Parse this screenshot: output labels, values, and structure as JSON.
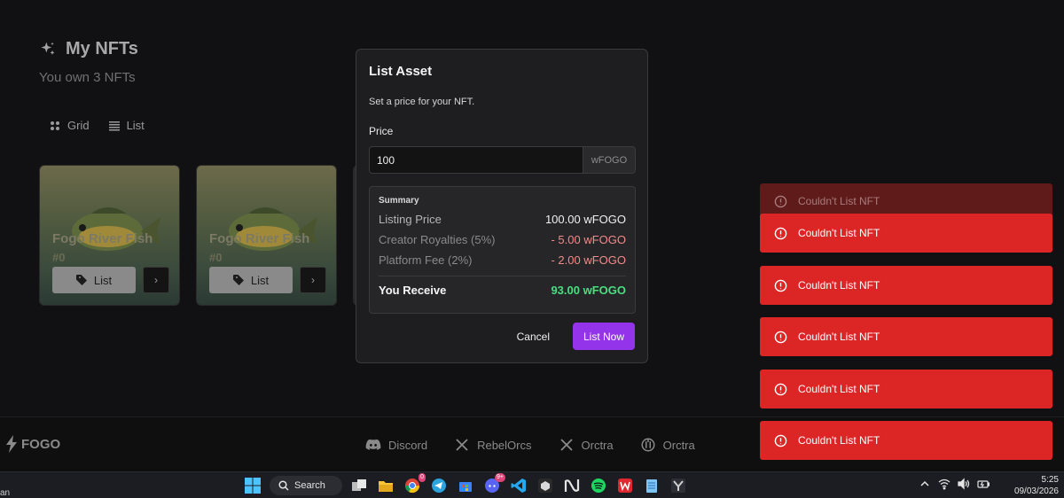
{
  "page": {
    "title": "My NFTs",
    "subtitle": "You own 3 NFTs",
    "view_toggle": {
      "grid_label": "Grid",
      "list_label": "List"
    },
    "cards": [
      {
        "name": "Fogo River Fish",
        "number": "#0",
        "list_label": "List"
      },
      {
        "name": "Fogo River Fish",
        "number": "#0",
        "list_label": "List"
      }
    ]
  },
  "footer": {
    "brand": "FOGO",
    "socials": [
      {
        "label": "Discord",
        "icon": "discord-icon"
      },
      {
        "label": "RebelOrcs",
        "icon": "x-icon"
      },
      {
        "label": "Orctra",
        "icon": "x-icon"
      },
      {
        "label": "Orctra",
        "icon": "gauge-icon"
      }
    ]
  },
  "modal": {
    "title": "List Asset",
    "description": "Set a price for your NFT.",
    "price_label": "Price",
    "price_value": "100",
    "currency": "wFOGO",
    "summary": {
      "title": "Summary",
      "listing_price_label": "Listing Price",
      "listing_price_value": "100.00 wFOGO",
      "royalties_label": "Creator Royalties (5%)",
      "royalties_value": "- 5.00 wFOGO",
      "platform_fee_label": "Platform Fee (2%)",
      "platform_fee_value": "- 2.00 wFOGO",
      "receive_label": "You Receive",
      "receive_value": "93.00 wFOGO"
    },
    "cancel_label": "Cancel",
    "list_now_label": "List Now"
  },
  "toasts": [
    {
      "message": "Couldn't List NFT"
    },
    {
      "message": "Couldn't List NFT"
    },
    {
      "message": "Couldn't List NFT"
    },
    {
      "message": "Couldn't List NFT"
    },
    {
      "message": "Couldn't List NFT"
    },
    {
      "message": "Couldn't List NFT"
    }
  ],
  "taskbar": {
    "left_text": "an",
    "search_label": "Search",
    "chrome_badge": "0",
    "discord_badge": "9+",
    "time": "5:25",
    "date": "09/03/2026"
  },
  "colors": {
    "accent": "#9333ea",
    "error": "#dc2626",
    "success": "#4ade80",
    "negative": "#f28b8b"
  }
}
